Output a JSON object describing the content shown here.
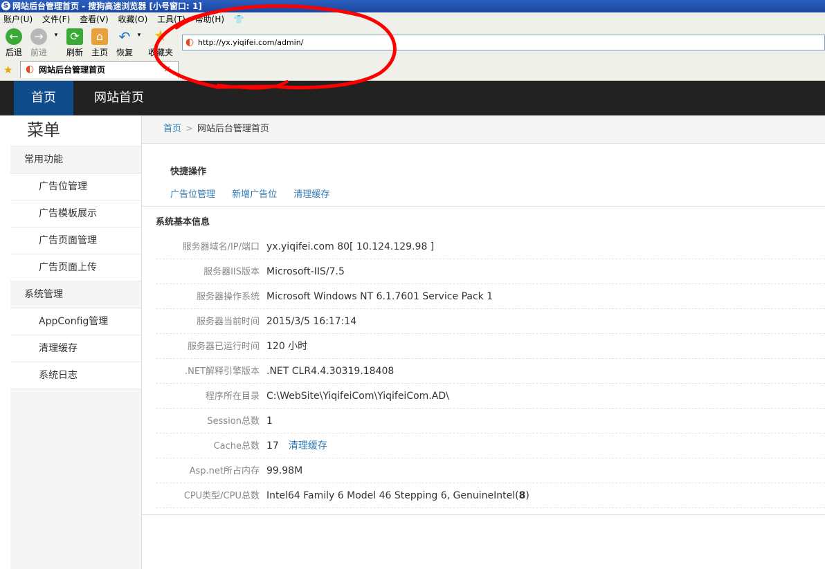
{
  "window": {
    "title": "网站后台管理首页 - 搜狗高速浏览器 [小号窗口: 1]"
  },
  "menubar": [
    {
      "label": "账户(U)"
    },
    {
      "label": "文件(F)"
    },
    {
      "label": "查看(V)"
    },
    {
      "label": "收藏(O)"
    },
    {
      "label": "工具(T)"
    },
    {
      "label": "帮助(H)"
    }
  ],
  "toolbar": {
    "back": "后退",
    "forward": "前进",
    "refresh": "刷新",
    "home": "主页",
    "restore": "恢复",
    "favorites": "收藏夹"
  },
  "address": {
    "url": "http://yx.yiqifei.com/admin/"
  },
  "tab": {
    "label": "网站后台管理首页",
    "close": "×"
  },
  "topnav": {
    "home": "首页",
    "site_home": "网站首页"
  },
  "sidebar": {
    "title": "菜单",
    "group1": "常用功能",
    "group1_items": [
      "广告位管理",
      "广告模板展示",
      "广告页面管理",
      "广告页面上传"
    ],
    "group2": "系统管理",
    "group2_items": [
      "AppConfig管理",
      "清理缓存",
      "系统日志"
    ]
  },
  "breadcrumb": {
    "home": "首页",
    "sep": ">",
    "current": "网站后台管理首页"
  },
  "quick": {
    "title": "快捷操作",
    "links": [
      "广告位管理",
      "新增广告位",
      "清理缓存"
    ]
  },
  "sysinfo": {
    "title": "系统基本信息",
    "rows": [
      {
        "label": "服务器域名/IP/端口",
        "value": "yx.yiqifei.com 80[ 10.124.129.98 ]"
      },
      {
        "label": "服务器IIS版本",
        "value": "Microsoft-IIS/7.5"
      },
      {
        "label": "服务器操作系统",
        "value": "Microsoft Windows NT 6.1.7601 Service Pack 1"
      },
      {
        "label": "服务器当前时间",
        "value": "2015/3/5 16:17:14"
      },
      {
        "label": "服务器已运行时间",
        "value": "120 小时"
      },
      {
        "label": ".NET解释引擎版本",
        "value": ".NET CLR4.4.30319.18408"
      },
      {
        "label": "程序所在目录",
        "value": "C:\\WebSite\\YiqifeiCom\\YiqifeiCom.AD\\"
      },
      {
        "label": "Session总数",
        "value": "1"
      },
      {
        "label": "Cache总数",
        "value": "17",
        "link": "清理缓存"
      },
      {
        "label": "Asp.net所占内存",
        "value": "99.98M"
      },
      {
        "label": "CPU类型/CPU总数",
        "value_prefix": "Intel64 Family 6 Model 46 Stepping 6, GenuineIntel(",
        "value_bold": "8",
        "value_suffix": ")"
      }
    ]
  },
  "colors": {
    "link": "#2f7bb5",
    "nav_active": "#0e4c8c",
    "nav_bg": "#222222",
    "annotation": "#ff0000"
  }
}
